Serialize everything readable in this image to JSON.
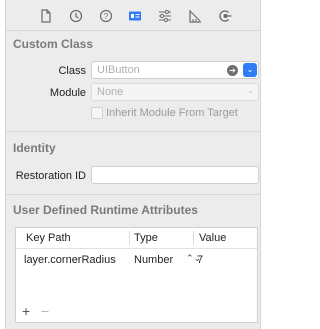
{
  "toolbar": {
    "icons": [
      "file-inspector-icon",
      "history-icon",
      "help-icon",
      "identity-inspector-icon",
      "attributes-inspector-icon",
      "size-inspector-icon",
      "connections-inspector-icon"
    ],
    "selected": "identity-inspector-icon",
    "accent": "#2f7cf6"
  },
  "custom_class": {
    "title": "Custom Class",
    "class_label": "Class",
    "class_placeholder": "UIButton",
    "module_label": "Module",
    "module_placeholder": "None",
    "inherit_label": "Inherit Module From Target"
  },
  "identity": {
    "title": "Identity",
    "restoration_label": "Restoration ID",
    "restoration_value": ""
  },
  "runtime_attributes": {
    "title": "User Defined Runtime Attributes",
    "columns": [
      "Key Path",
      "Type",
      "Value"
    ],
    "rows": [
      {
        "key_path": "layer.cornerRadius",
        "type": "Number",
        "value": "7"
      }
    ],
    "add_label": "+",
    "remove_label": "−"
  }
}
